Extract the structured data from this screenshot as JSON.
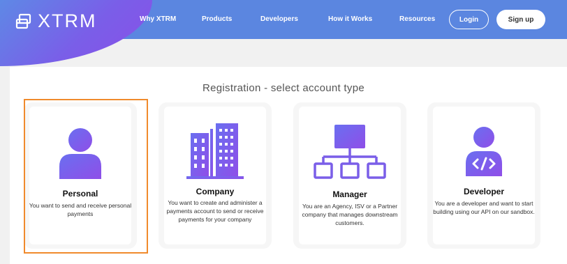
{
  "header": {
    "logo_text": "XTRM",
    "nav": [
      {
        "label": "Why XTRM"
      },
      {
        "label": "Products"
      },
      {
        "label": "Developers"
      },
      {
        "label": "How it Works"
      },
      {
        "label": "Resources"
      }
    ],
    "login_label": "Login",
    "signup_label": "Sign up"
  },
  "page_title": "Registration - select account type",
  "cards": [
    {
      "name": "Personal",
      "description": "You want to send and receive personal payments",
      "icon": "person-icon",
      "selected": true
    },
    {
      "name": "Company",
      "description": "You want to create and administer a payments account to send or receive payments for your company",
      "icon": "buildings-icon",
      "selected": false
    },
    {
      "name": "Manager",
      "description": "You are an Agency, ISV or a Partner company that manages downstream customers.",
      "icon": "org-chart-icon",
      "selected": false
    },
    {
      "name": "Developer",
      "description": "You are a developer and want to start building using our API on our sandbox.",
      "icon": "developer-icon",
      "selected": false
    }
  ],
  "colors": {
    "header_blue": "#5b86e0",
    "accent_purple": "#8a4fe8",
    "selection_orange": "#f08a2c"
  }
}
